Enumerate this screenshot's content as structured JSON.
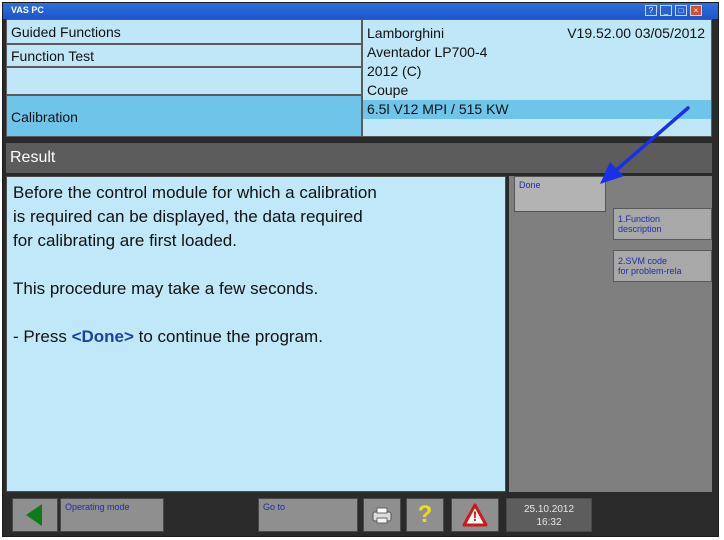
{
  "window": {
    "title": "VAS PC",
    "controls": {
      "help": "?",
      "minimize": "_",
      "maximize": "□",
      "close": "×"
    }
  },
  "header": {
    "guided_functions": "Guided Functions",
    "function_test": "Function Test",
    "calibration": "Calibration",
    "vehicle": {
      "make": "Lamborghini",
      "version": "V19.52.00 03/05/2012",
      "model": "Aventador LP700-4",
      "year": "2012 (C)",
      "body": "Coupe",
      "engine": "6.5l V12 MPI / 515 KW"
    }
  },
  "result": {
    "title": "Result",
    "line1": "Before the control module for which a calibration",
    "line2": "is required can be displayed, the data required",
    "line3": "for calibrating are first loaded.",
    "line4": "This procedure may take a few seconds.",
    "line5_prefix": "- Press ",
    "line5_done": "<Done>",
    "line5_suffix": " to continue the program."
  },
  "side_buttons": {
    "done": "Done",
    "function_description_1": "1.Function",
    "function_description_2": "description",
    "svm_code_1": "2.SVM code",
    "svm_code_2": "for problem-rela"
  },
  "bottom": {
    "operating_mode": "Operating mode",
    "go_to": "Go to",
    "help_glyph": "?",
    "warning_glyph": "!",
    "date": "25.10.2012",
    "time": "16:32"
  },
  "colors": {
    "panel_light": "#bfe7f7",
    "panel_selected": "#6fc4ea",
    "button_text": "#1e2fa6",
    "annotation_arrow": "#1a2fe8"
  }
}
